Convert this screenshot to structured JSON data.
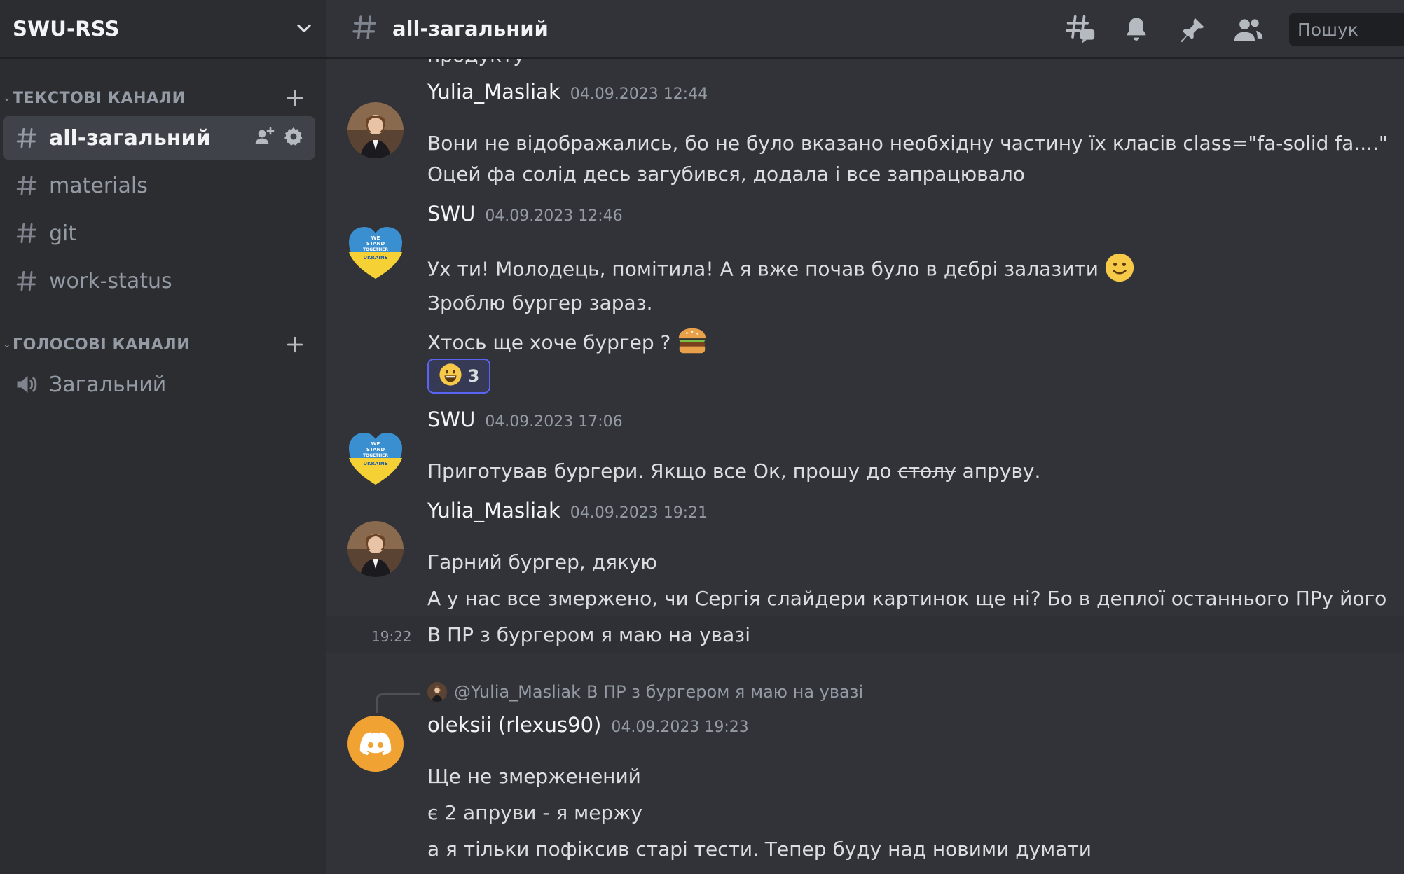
{
  "server": {
    "name": "SWU-RSS"
  },
  "categories": {
    "text": {
      "label": "ТЕКСТОВІ КАНАЛИ"
    },
    "voice": {
      "label": "ГОЛОСОВІ КАНАЛИ"
    }
  },
  "channels": [
    {
      "label": "all-загальний",
      "active": true
    },
    {
      "label": "materials"
    },
    {
      "label": "git"
    },
    {
      "label": "work-status"
    }
  ],
  "voice_channels": [
    {
      "label": "Загальний"
    }
  ],
  "topbar": {
    "channel_title": "all-загальний",
    "search_placeholder": "Пошук",
    "icons": [
      "threads-icon",
      "bell-icon",
      "pin-icon",
      "members-icon"
    ]
  },
  "messages": {
    "partial_top": "продукту",
    "m1": {
      "author": "Yulia_Masliak",
      "timestamp": "04.09.2023 12:44",
      "lines": [
        "Вони не відображались, бо не було вказано необхідну частину їх класів class=\"fa-solid fa....\"",
        "Оцей фа солід десь загубився, додала і все запрацювало"
      ]
    },
    "m2": {
      "author": "SWU",
      "timestamp": "04.09.2023 12:46",
      "lines": [
        "Ух ти! Молодець, помітила! А я вже почав було в дєбрі залазити",
        "Зроблю бургер зараз.",
        "Хтось ще хоче бургер ?"
      ],
      "reaction_count": "3"
    },
    "m3": {
      "author": "SWU",
      "timestamp": "04.09.2023 17:06",
      "text_before": "Приготував бургери. Якщо все Ок, прошу до ",
      "text_struck": "столу",
      "text_after": " апруву."
    },
    "m4": {
      "author": "Yulia_Masliak",
      "timestamp": "04.09.2023 19:21",
      "lines": [
        "Гарний бургер, дякую",
        "А у нас все змержено, чи Сергія слайдери картинок ще ні? Бо в деплої останнього ПРу його немає"
      ],
      "followup_time": "19:22",
      "followup": "В ПР з бургером я маю на увазі"
    },
    "m5": {
      "reply_mention": "@Yulia_Masliak",
      "reply_snippet": "В ПР з бургером я маю на увазі",
      "author": "oleksii (rlexus90)",
      "timestamp": "04.09.2023 19:23",
      "lines": [
        "Ще не змерженений",
        "є 2 апруви - я мержу",
        "а я тільки пофіксив старі тести. Тепер буду над новими думати"
      ]
    }
  },
  "colors": {
    "accent": "#5865f2",
    "discord_avatar": "#f0a232",
    "sidebar_bg": "#2b2d31",
    "chat_bg": "#313338"
  }
}
